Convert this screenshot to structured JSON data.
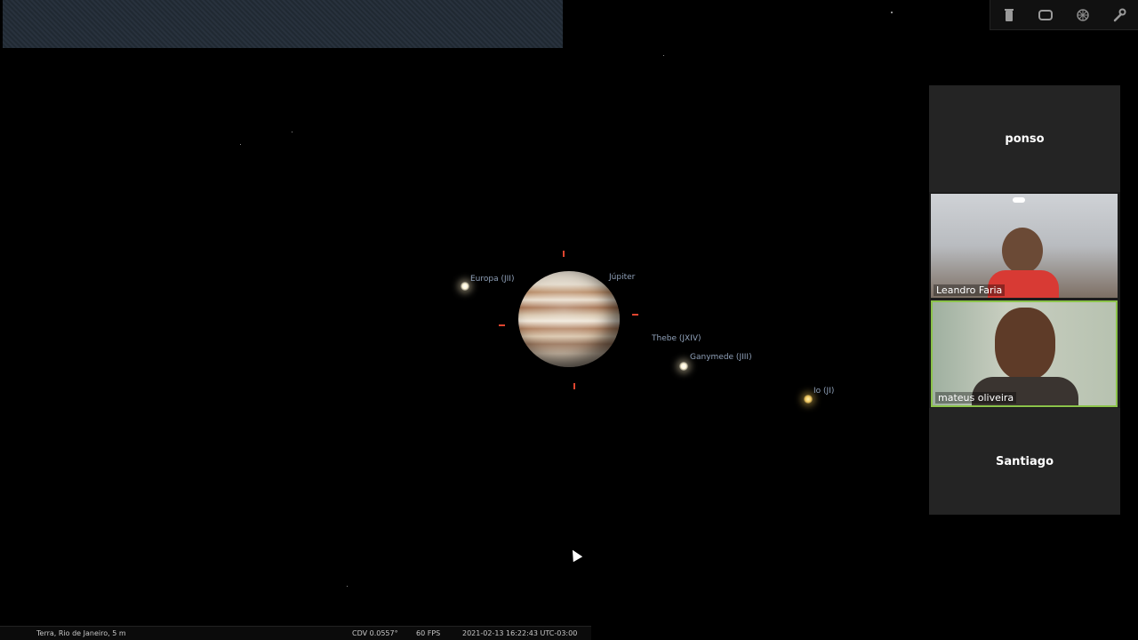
{
  "toolbar": {
    "icons": [
      "trash-icon",
      "screen-icon",
      "web-icon",
      "wrench-icon"
    ]
  },
  "sky": {
    "planet": {
      "label": "Júpiter"
    },
    "moons": [
      {
        "key": "europa",
        "label": "Europa (JII)"
      },
      {
        "key": "thebe",
        "label": "Thebe (JXIV)"
      },
      {
        "key": "ganymede",
        "label": "Ganymede (JIII)"
      },
      {
        "key": "io",
        "label": "Io (JI)"
      }
    ]
  },
  "status_bar": {
    "location": "Terra, Rio de Janeiro, 5 m",
    "fov": "CDV 0.0557°",
    "fps": "60 FPS",
    "datetime": "2021-02-13 16:22:43 UTC-03:00"
  },
  "participants": [
    {
      "name": "ponso",
      "video": false
    },
    {
      "name": "Leandro Faria",
      "video": true
    },
    {
      "name": "mateus oliveira",
      "video": true,
      "active_speaker": true
    },
    {
      "name": "Santiago",
      "video": false
    }
  ]
}
